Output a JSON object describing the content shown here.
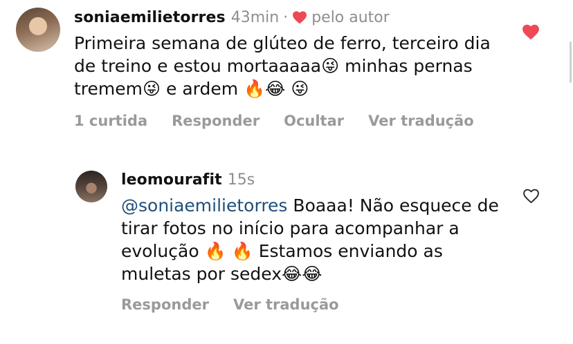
{
  "comment": {
    "username": "soniaemilietorres",
    "time": "43min",
    "separator": "·",
    "liked_by_author_label": "pelo autor",
    "text": "Primeira semana de glúteo de ferro, terceiro dia de treino e estou mortaaaaa😜 minhas pernas tremem😜 e ardem 🔥😂 😜",
    "likes_label": "1 curtida",
    "reply_label": "Responder",
    "hide_label": "Ocultar",
    "translate_label": "Ver tradução",
    "liked": true
  },
  "reply": {
    "username": "leomourafit",
    "time": "15s",
    "mention": "@soniaemilietorres",
    "text": " Boaaa! Não esquece de tirar fotos no início para acompanhar a evolução 🔥 🔥 Estamos enviando as muletas por sedex😂😂",
    "reply_label": "Responder",
    "translate_label": "Ver tradução",
    "liked": false
  },
  "colors": {
    "heart_red": "#ed4956",
    "muted": "#8e8e8e",
    "mention": "#1f4f7a"
  },
  "icons": {
    "like_filled": "heart-filled-icon",
    "like_outline": "heart-outline-icon"
  }
}
